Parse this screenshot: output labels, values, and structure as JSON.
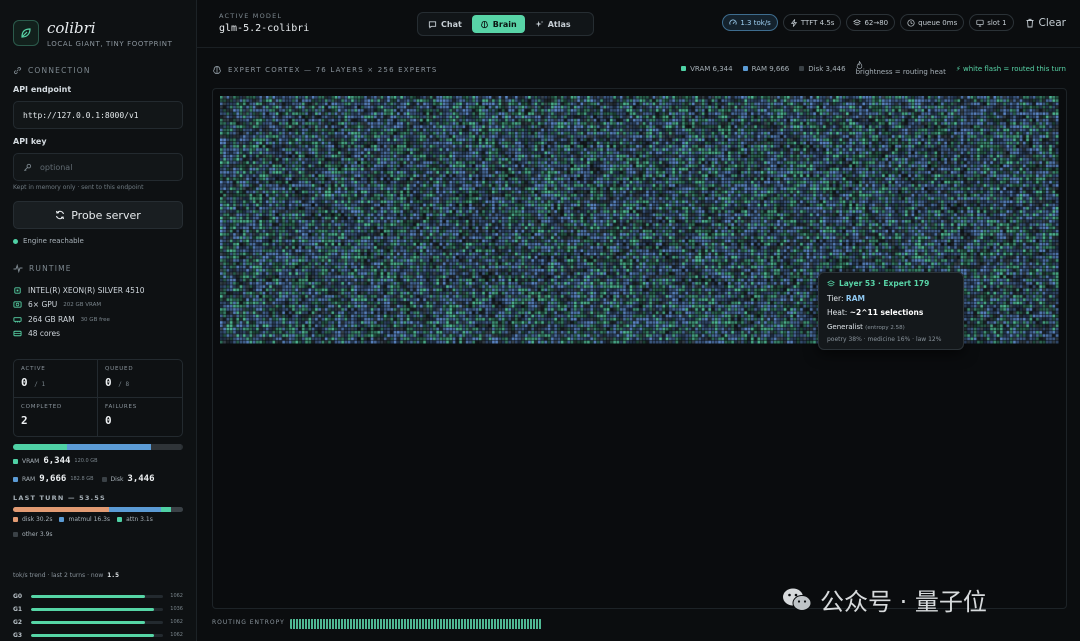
{
  "brand": {
    "name": "colibri",
    "tagline": "LOCAL GIANT, TINY FOOTPRINT"
  },
  "connection": {
    "section_title": "CONNECTION",
    "endpoint_label": "API endpoint",
    "endpoint_value": "http://127.0.0.1:8000/v1",
    "key_label": "API key",
    "key_placeholder": "optional",
    "key_hint": "Kept in memory only · sent to this endpoint",
    "probe_label": "Probe server",
    "status": "Engine reachable"
  },
  "runtime": {
    "section_title": "RUNTIME",
    "cpu": "INTEL(R) XEON(R) SILVER 4510",
    "gpu": "6× GPU",
    "gpu_sub": "202 GB VRAM",
    "ram": "264 GB RAM",
    "ram_sub": "30 GB free",
    "cores": "48 cores"
  },
  "stats": {
    "active_label": "ACTIVE",
    "active_value": "0",
    "active_of": "/ 1",
    "queued_label": "QUEUED",
    "queued_value": "0",
    "queued_of": "/ 8",
    "completed_label": "COMPLETED",
    "completed_value": "2",
    "failures_label": "FAILURES",
    "failures_value": "0"
  },
  "tiers": {
    "vram_label": "VRAM",
    "vram_count": "6,344",
    "vram_size": "120.0 GB",
    "ram_label": "RAM",
    "ram_count": "9,666",
    "ram_size": "182.8 GB",
    "disk_label": "Disk",
    "disk_count": "3,446",
    "bar_fractions": [
      0.32,
      0.49,
      0.18
    ],
    "colors": [
      "#4fd1a5",
      "#5b9bd5",
      "#2f3438"
    ]
  },
  "last_turn": {
    "title": "LAST TURN — 53.5S",
    "disk": "disk 30.2s",
    "matmul": "matmul 16.3s",
    "attn": "attn 3.1s",
    "other": "other 3.9s",
    "bar_fractions": [
      0.564,
      0.305,
      0.058,
      0.073
    ],
    "colors": [
      "#e29b73",
      "#5b9bd5",
      "#4fd1a5",
      "#3a4146"
    ]
  },
  "trend": {
    "text": "tok/s trend · last 2 turns · now",
    "now": "1.5"
  },
  "gpus": [
    {
      "label": "G0",
      "value": "1062",
      "fill": 0.86
    },
    {
      "label": "G1",
      "value": "1036",
      "fill": 0.93
    },
    {
      "label": "G2",
      "value": "1062",
      "fill": 0.86
    },
    {
      "label": "G3",
      "value": "1062",
      "fill": 0.93
    }
  ],
  "header": {
    "active_model_label": "ACTIVE MODEL",
    "active_model": "glm-5.2-colibri",
    "tabs": [
      "Chat",
      "Brain",
      "Atlas"
    ],
    "active_tab": "Brain",
    "pills": [
      "1.3 tok/s",
      "TTFT 4.5s",
      "62→80",
      "queue 0ms",
      "slot 1"
    ],
    "clear_label": "Clear"
  },
  "cortex": {
    "title": "EXPERT CORTEX — 76 LAYERS × 256 EXPERTS",
    "legend_vram": "VRAM 6,344",
    "legend_ram": "RAM 9,666",
    "legend_disk": "Disk 3,446",
    "legend_heat": "brightness = routing heat",
    "legend_flash": "⚡ white flash = routed this turn",
    "layers": 76,
    "experts": 256,
    "filled_rows": 76,
    "tier_colors": {
      "vram": "#4fb893",
      "ram": "#5b86c4",
      "disk": "#3a4650"
    }
  },
  "tooltip": {
    "title": "Layer 53 · Expert 179",
    "tier_label": "Tier:",
    "tier_value": "RAM",
    "heat_label": "Heat:",
    "heat_value": "~2^11 selections",
    "kind": "Generalist",
    "entropy": "(entropy 2.58)",
    "topics": "poetry 38% · medicine 16% · law 12%"
  },
  "entropy": {
    "label": "ROUTING ENTROPY"
  },
  "watermark": {
    "text": "公众号 · 量子位"
  }
}
